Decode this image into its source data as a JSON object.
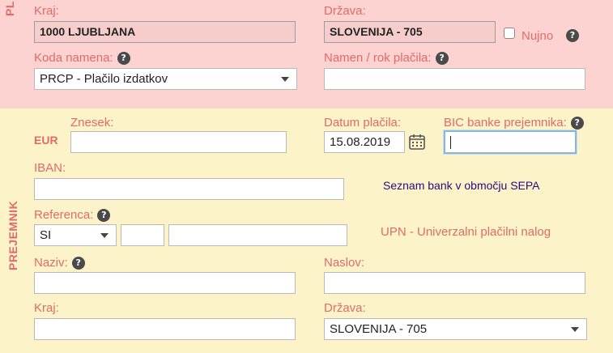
{
  "payer": {
    "section_label": "PL",
    "city": {
      "label": "Kraj:",
      "value": "1000 LJUBLJANA"
    },
    "country": {
      "label": "Država:",
      "value": "SLOVENIJA - 705"
    },
    "urgent": {
      "label": "Nujno",
      "checked": false
    },
    "purpose_code": {
      "label": "Koda namena:",
      "selected": "PRCP - Plačilo izdatkov"
    },
    "purpose": {
      "label": "Namen / rok plačila:",
      "value": ""
    }
  },
  "recipient": {
    "section_label": "PREJEMNIK",
    "amount": {
      "label": "Znesek:",
      "currency": "EUR",
      "value": ""
    },
    "payment_date": {
      "label": "Datum plačila:",
      "value": "15.08.2019"
    },
    "bic": {
      "label": "BIC banke prejemnika:",
      "value": ""
    },
    "iban": {
      "label": "IBAN:",
      "value": ""
    },
    "sepa_link": "Seznam bank v območju SEPA",
    "reference": {
      "label": "Referenca:",
      "model": "SI",
      "part1": "",
      "part2": ""
    },
    "upn_link": "UPN - Univerzalni plačilni nalog",
    "name": {
      "label": "Naziv:",
      "value": ""
    },
    "address": {
      "label": "Naslov:",
      "value": ""
    },
    "city": {
      "label": "Kraj:",
      "value": ""
    },
    "country": {
      "label": "Država:",
      "selected": "SLOVENIJA - 705"
    }
  },
  "help_symbol": "?",
  "colors": {
    "payer_bg": "#fcd3d0",
    "recipient_bg": "#fcf4c8",
    "label": "#e26a6a",
    "link_sepa": "#2a0a7a",
    "focus_border": "#8ab6db"
  }
}
